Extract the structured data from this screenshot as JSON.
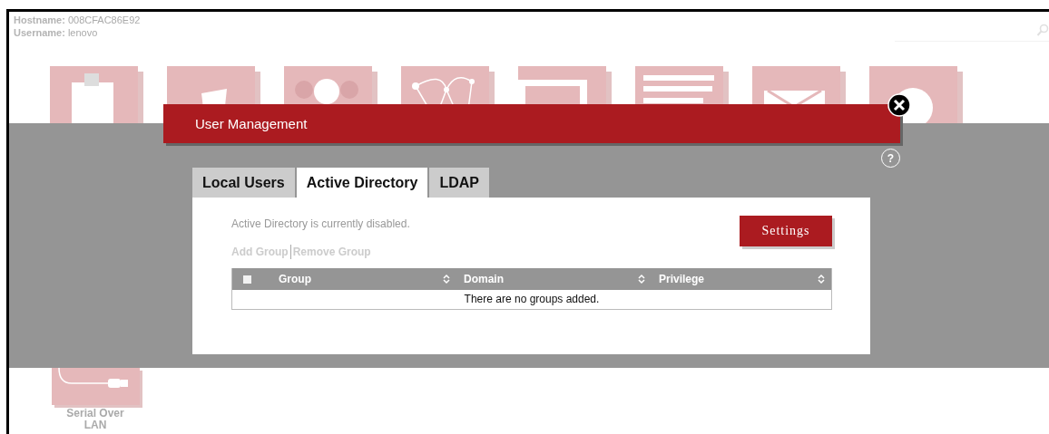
{
  "header": {
    "hostname_label": "Hostname:",
    "hostname": "008CFAC86E92",
    "username_label": "Username:",
    "username": "lenovo"
  },
  "tiles": [
    {
      "kind": "clipboard"
    },
    {
      "kind": "cup"
    },
    {
      "kind": "people"
    },
    {
      "kind": "network"
    },
    {
      "kind": "frame"
    },
    {
      "kind": "list"
    },
    {
      "kind": "mail"
    },
    {
      "kind": "clock"
    }
  ],
  "bottom_tile": {
    "kind": "cable",
    "label": "Serial Over LAN"
  },
  "dialog": {
    "title": "User Management",
    "help": "?",
    "tabs": [
      {
        "label": "Local Users",
        "selected": false
      },
      {
        "label": "Active Directory",
        "selected": true
      },
      {
        "label": "LDAP",
        "selected": false
      }
    ],
    "status": "Active Directory is currently disabled.",
    "settings_button": "Settings",
    "actions": [
      {
        "label": "Add Group",
        "disabled": true
      },
      {
        "label": "Remove Group",
        "disabled": true
      }
    ],
    "table": {
      "select_all": {
        "checked": false
      },
      "columns": [
        "Group",
        "Domain",
        "Privilege"
      ],
      "empty_message": "There are no groups added."
    }
  }
}
